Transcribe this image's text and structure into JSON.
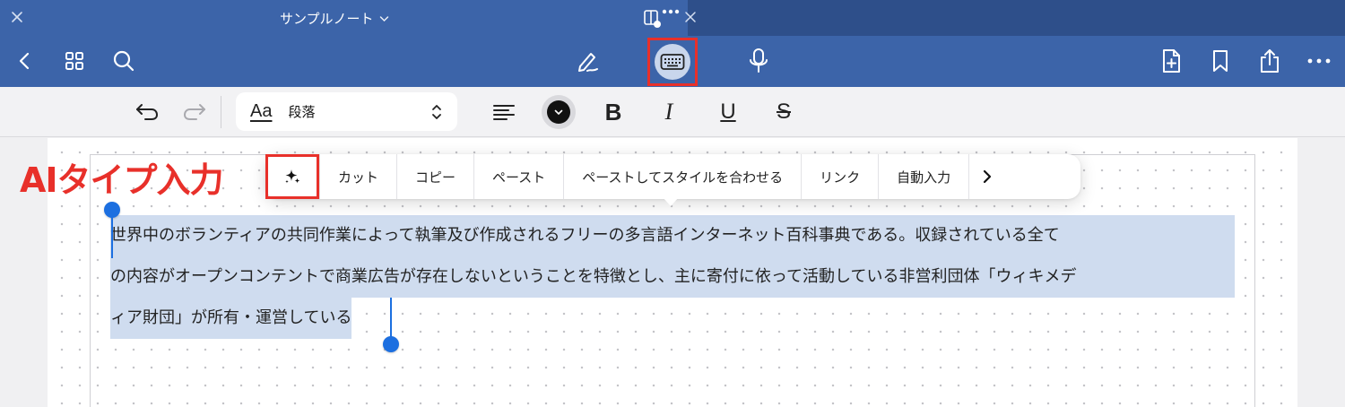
{
  "window": {
    "tab_title": "サンプルノート",
    "colors": {
      "toolbar": "#3c64a9",
      "tab_inactive": "#2e4f8a",
      "highlight": "#e8302a",
      "selection": "#cfdcef",
      "handle": "#1c6fe0"
    }
  },
  "toolbar": {
    "left_icons": [
      "back-icon",
      "grid-icon",
      "search-icon"
    ],
    "center_icons": [
      "pen-icon",
      "keyboard-icon",
      "microphone-icon"
    ],
    "right_icons": [
      "add-page-icon",
      "bookmark-icon",
      "share-icon",
      "more-icon"
    ]
  },
  "format_bar": {
    "style_prefix": "Aa",
    "paragraph_style": "段落",
    "bold_label": "B",
    "italic_label": "I",
    "underline_label": "U",
    "strike_label": "S"
  },
  "context_menu": {
    "items": [
      "カット",
      "コピー",
      "ペースト",
      "ペーストしてスタイルを合わせる",
      "リンク",
      "自動入力"
    ]
  },
  "annotation": "AIタイプ入力",
  "document": {
    "lines": [
      "世界中のボランティアの共同作業によって執筆及び作成されるフリーの多言語インターネット百科事典である。収録されている全て",
      "の内容がオープンコンテントで商業広告が存在しないということを特徴とし、主に寄付に依って活動している非営利団体「ウィキメデ",
      "ィア財団」が所有・運営している"
    ]
  }
}
